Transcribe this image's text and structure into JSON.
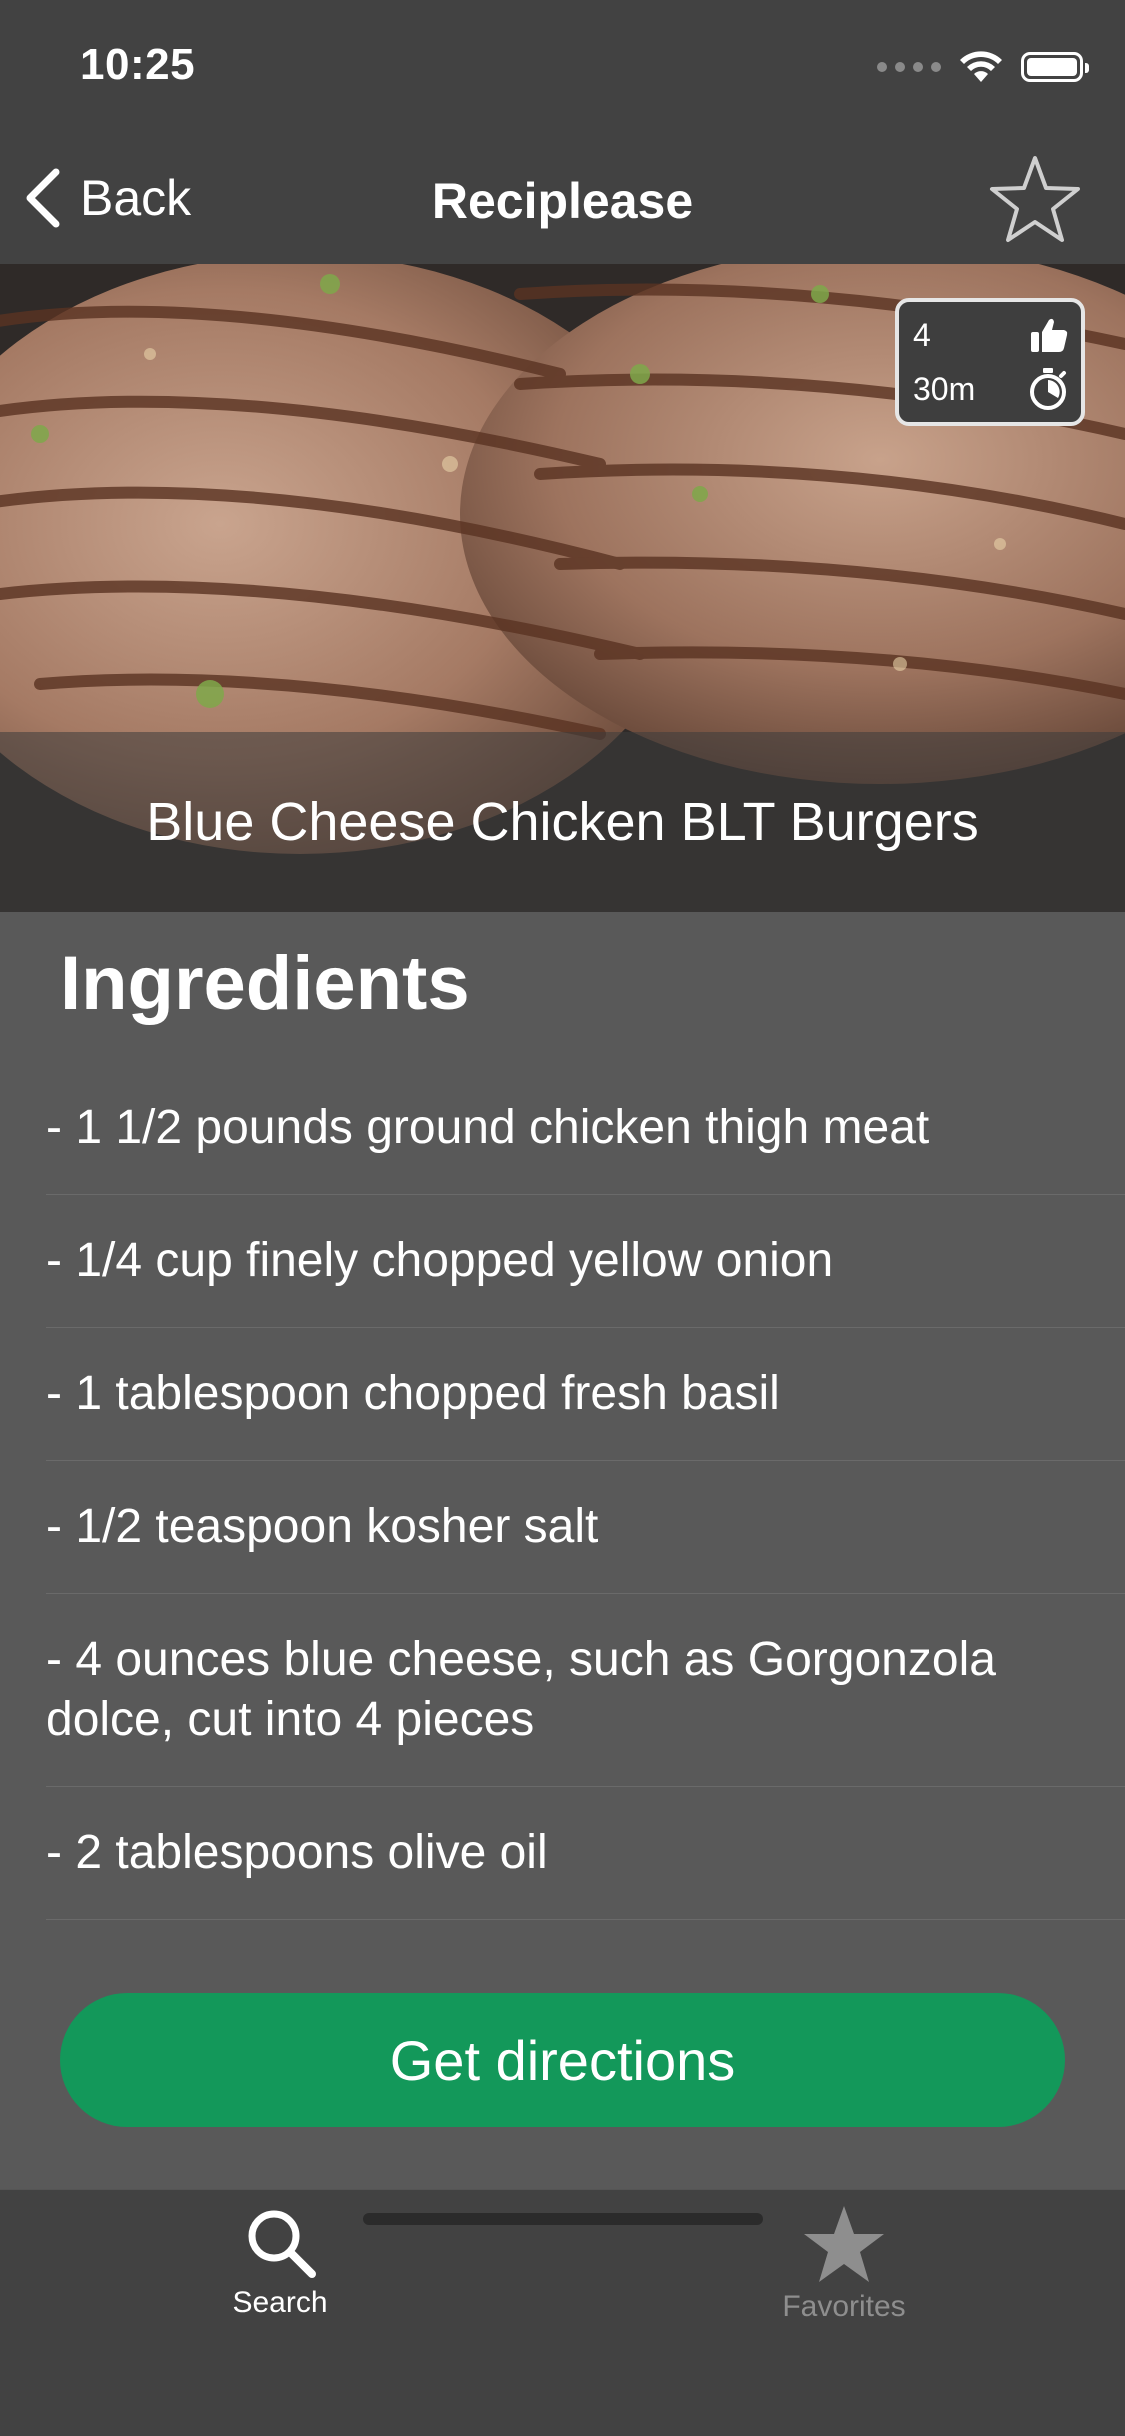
{
  "status_bar": {
    "time": "10:25",
    "icons": [
      "cellular-signal-icon",
      "wifi-icon",
      "battery-icon"
    ]
  },
  "nav": {
    "back_label": "Back",
    "title": "Reciplease",
    "favorite_icon": "star-outline-icon"
  },
  "recipe": {
    "title": "Blue Cheese Chicken BLT Burgers",
    "likes": "4",
    "time": "30m",
    "image": "grilled-chicken-burger-patties"
  },
  "ingredients": {
    "heading": "Ingredients",
    "items": [
      "- 1 1/2 pounds ground chicken thigh meat",
      "- 1/4 cup finely chopped yellow onion",
      "- 1 tablespoon chopped fresh basil",
      "- 1/2 teaspoon kosher salt",
      "- 4 ounces blue cheese, such as Gorgonzola dolce, cut into 4 pieces",
      "- 2 tablespoons olive oil"
    ]
  },
  "actions": {
    "directions_label": "Get directions"
  },
  "tab_bar": {
    "tabs": [
      {
        "label": "Search",
        "icon": "search-icon",
        "selected": true
      },
      {
        "label": "Favorites",
        "icon": "star-filled-icon",
        "selected": false
      }
    ]
  },
  "colors": {
    "background": "#595959",
    "bars": "#424242",
    "accent_green": "#13985a",
    "inactive_tab": "#8e8e8e"
  }
}
